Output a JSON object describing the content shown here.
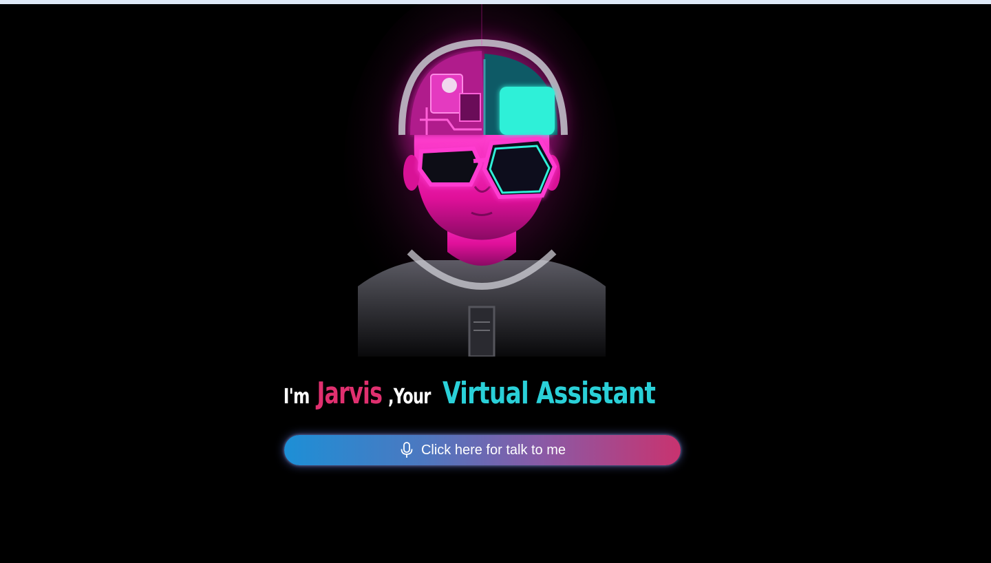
{
  "page": {
    "background": "#000000",
    "top_strip_color": "#dfe9f8"
  },
  "avatar": {
    "icon": "neon-cyber-avatar",
    "colors": {
      "neon_pink": "#ff1fc8",
      "neon_cyan": "#2ff0d8",
      "skin": "#e0109a"
    }
  },
  "headline": {
    "part1": "I'm",
    "name": "Jarvis",
    "part2": ",Your",
    "part3": "Virtual Assistant",
    "colors": {
      "white": "#ffffff",
      "name": "#e0306f",
      "accent": "#2ad0d8"
    }
  },
  "talk_button": {
    "icon": "microphone-icon",
    "label": "Click here for talk to me",
    "gradient": [
      "#1d8fd6",
      "#c8336f"
    ]
  }
}
